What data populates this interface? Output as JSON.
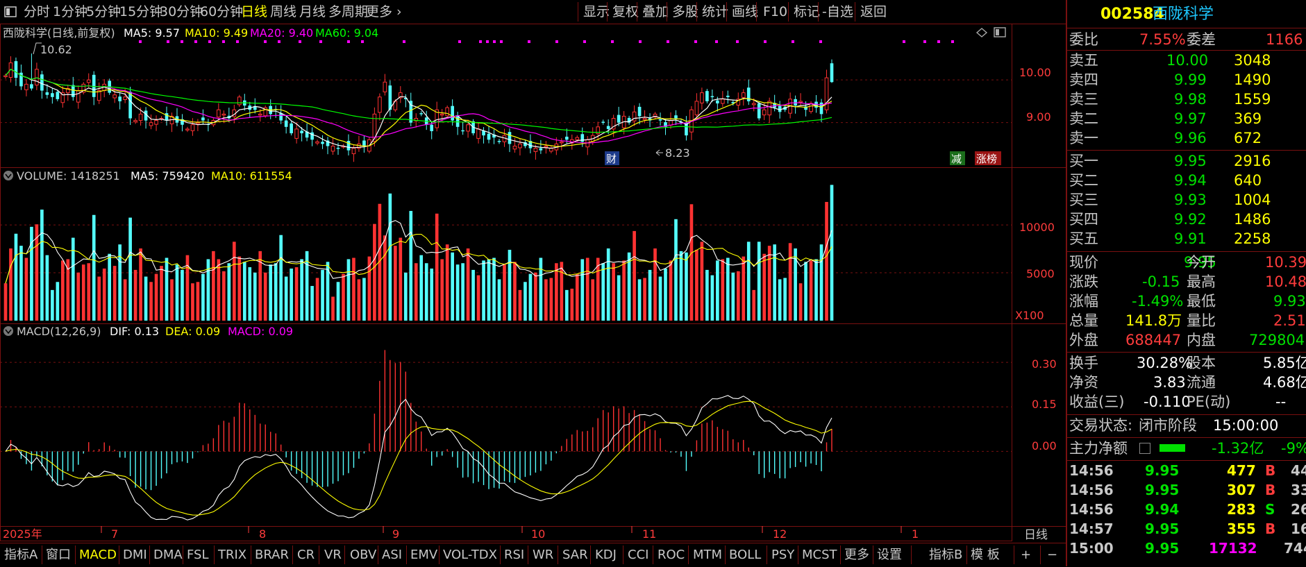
{
  "topbar": {
    "menu_icon": "menu-icon",
    "periods": [
      "分时",
      "1分钟",
      "5分钟",
      "15分钟",
      "30分钟",
      "60分钟",
      "日线",
      "周线",
      "月线",
      "多周期",
      "更多"
    ],
    "active_period": "日线",
    "tools": [
      "显示",
      "复权",
      "叠加",
      "多股",
      "统计",
      "画线",
      "F10",
      "标记",
      "-自选",
      "返回"
    ]
  },
  "panels": {
    "kline_title": "西陇科学(日线,前复权)",
    "ma_labels": [
      {
        "text": "MA5: 9.57",
        "color": "#ffffff"
      },
      {
        "text": "MA10: 9.49",
        "color": "#ffff00"
      },
      {
        "text": "MA20: 9.40",
        "color": "#ff00ff"
      },
      {
        "text": "MA60: 9.04",
        "color": "#00ff00"
      }
    ],
    "kline_axis": [
      "10.00",
      "9.00"
    ],
    "high_label": "10.62",
    "low_label": "8.23",
    "badge_cai": "财",
    "badge_jian": "减",
    "badge_zhangbang": "涨榜",
    "volume_title": "VOLUME: 1418251",
    "vol_ma_labels": [
      {
        "text": "MA5: 759420",
        "color": "#ffffff"
      },
      {
        "text": "MA10: 611554",
        "color": "#ffff00"
      }
    ],
    "volume_axis": [
      "10000",
      "5000"
    ],
    "volume_unit": "X100",
    "macd_title": "MACD(12,26,9)",
    "macd_labels": [
      {
        "text": "DIF: 0.13",
        "color": "#ffffff"
      },
      {
        "text": "DEA: 0.09",
        "color": "#ffff00"
      },
      {
        "text": "MACD: 0.09",
        "color": "#ff00ff"
      }
    ],
    "macd_axis": [
      "0.30",
      "0.15",
      "0.00"
    ],
    "date_labels": [
      "2025年",
      "7",
      "8",
      "9",
      "10",
      "11",
      "12",
      "1"
    ],
    "period_name": "日线"
  },
  "chart_data": {
    "type": "candlestick",
    "title": "西陇科学(日线,前复权)",
    "x": "trading days, 2025年6月 – 2026年1月",
    "date_ticks": [
      "2025年",
      "7",
      "8",
      "9",
      "10",
      "11",
      "12",
      "1"
    ],
    "close": [
      10.1,
      10.4,
      10.05,
      9.85,
      9.9,
      9.8,
      10.25,
      9.75,
      9.65,
      9.6,
      9.55,
      9.7,
      9.8,
      9.6,
      9.75,
      9.9,
      10.0,
      9.6,
      9.75,
      9.9,
      9.7,
      9.65,
      9.5,
      9.6,
      9.1,
      9.05,
      9.2,
      9.05,
      9.0,
      9.05,
      9.1,
      9.05,
      9.15,
      9.0,
      8.95,
      8.85,
      8.95,
      9.0,
      9.05,
      8.95,
      9.05,
      9.3,
      9.2,
      9.1,
      9.3,
      9.6,
      9.4,
      9.3,
      9.3,
      9.2,
      9.35,
      9.2,
      9.3,
      9.05,
      8.9,
      8.75,
      8.85,
      8.75,
      8.65,
      8.6,
      8.55,
      8.5,
      8.45,
      8.45,
      8.4,
      8.45,
      8.35,
      8.4,
      8.5,
      8.45,
      8.6,
      9.2,
      9.6,
      9.95,
      9.3,
      9.5,
      9.7,
      9.55,
      9.0,
      9.1,
      9.2,
      8.95,
      8.8,
      9.3,
      9.2,
      9.35,
      9.05,
      8.9,
      8.8,
      8.95,
      8.75,
      8.85,
      8.7,
      8.6,
      8.65,
      8.55,
      8.7,
      8.5,
      8.45,
      8.5,
      8.45,
      8.4,
      8.4,
      8.35,
      8.45,
      8.4,
      8.5,
      8.55,
      8.6,
      8.6,
      8.65,
      8.55,
      8.6,
      8.7,
      8.9,
      9.0,
      8.85,
      9.1,
      9.0,
      9.15,
      9.0,
      9.25,
      9.15,
      9.1,
      9.05,
      9.2,
      9.05,
      8.9,
      9.05,
      9.1,
      9.0,
      8.7,
      9.3,
      9.5,
      9.7,
      9.5,
      9.6,
      9.45,
      9.55,
      9.6,
      9.45,
      9.55,
      9.7,
      9.5,
      9.45,
      9.1,
      9.3,
      9.5,
      9.35,
      9.25,
      9.3,
      9.55,
      9.4,
      9.5,
      9.3,
      9.45,
      9.35,
      9.2,
      10.05,
      9.95
    ],
    "ma": {
      "MA5": 9.57,
      "MA10": 9.49,
      "MA20": 9.4,
      "MA60": 9.04
    },
    "high_marker": 10.62,
    "low_marker": 8.23,
    "ylim_price": [
      8.1,
      10.8
    ],
    "volume_last": 1418251,
    "volume_unit": "X100",
    "ylim_volume": [
      0,
      14500
    ],
    "macd": {
      "DIF": 0.13,
      "DEA": 0.09,
      "MACD": 0.09
    },
    "ylim_macd": [
      -0.28,
      0.38
    ]
  },
  "quote": {
    "code": "002584",
    "name": "西陇科学",
    "weibi_label": "委比",
    "weibi_value": "7.55%",
    "weicha_label": "委差",
    "weicha_value": "1166",
    "asks": [
      {
        "label": "卖五",
        "price": "10.00",
        "vol": "3048"
      },
      {
        "label": "卖四",
        "price": "9.99",
        "vol": "1490"
      },
      {
        "label": "卖三",
        "price": "9.98",
        "vol": "1559"
      },
      {
        "label": "卖二",
        "price": "9.97",
        "vol": "369"
      },
      {
        "label": "卖一",
        "price": "9.96",
        "vol": "672"
      }
    ],
    "bids": [
      {
        "label": "买一",
        "price": "9.95",
        "vol": "2916"
      },
      {
        "label": "买二",
        "price": "9.94",
        "vol": "640"
      },
      {
        "label": "买三",
        "price": "9.93",
        "vol": "1004"
      },
      {
        "label": "买四",
        "price": "9.92",
        "vol": "1486"
      },
      {
        "label": "买五",
        "price": "9.91",
        "vol": "2258"
      }
    ],
    "stats": [
      {
        "l1": "现价",
        "v1": "9.95",
        "c1": "#00e000",
        "l2": "今开",
        "v2": "10.39",
        "c2": "#ff3c3c"
      },
      {
        "l1": "涨跌",
        "v1": "-0.15",
        "c1": "#00e000",
        "l2": "最高",
        "v2": "10.48",
        "c2": "#ff3c3c"
      },
      {
        "l1": "涨幅",
        "v1": "-1.49%",
        "c1": "#00e000",
        "l2": "最低",
        "v2": "9.93",
        "c2": "#00e000"
      },
      {
        "l1": "总量",
        "v1": "141.8万",
        "c1": "#ffff00",
        "l2": "量比",
        "v2": "2.51",
        "c2": "#ff3c3c"
      },
      {
        "l1": "外盘",
        "v1": "688447",
        "c1": "#ff3c3c",
        "l2": "内盘",
        "v2": "729804",
        "c2": "#00e000"
      }
    ],
    "stats2": [
      {
        "l1": "换手",
        "v1": "30.28%",
        "l2": "股本",
        "v2": "5.85亿"
      },
      {
        "l1": "净资",
        "v1": "3.83",
        "l2": "流通",
        "v2": "4.68亿"
      },
      {
        "l1": "收益(三)",
        "v1": "-0.110",
        "l2": "PE(动)",
        "v2": "--"
      }
    ],
    "status_label": "交易状态:",
    "status_value": "闭市阶段",
    "status_time": "15:00:00",
    "flow_label": "主力净额",
    "flow_value": "-1.32亿",
    "flow_pct": "-9%",
    "ticks": [
      {
        "time": "14:56",
        "price": "9.95",
        "vol": "477",
        "side": "B",
        "num": "44"
      },
      {
        "time": "14:56",
        "price": "9.95",
        "vol": "307",
        "side": "B",
        "num": "33"
      },
      {
        "time": "14:56",
        "price": "9.94",
        "vol": "283",
        "side": "S",
        "num": "26"
      },
      {
        "time": "14:57",
        "price": "9.95",
        "vol": "355",
        "side": "B",
        "num": "16"
      },
      {
        "time": "15:00",
        "price": "9.95",
        "vol": "17132",
        "side": "",
        "num": "744"
      }
    ]
  },
  "bottombar": {
    "left_items": [
      "指标A",
      "窗口",
      "MACD",
      "DMI",
      "DMA",
      "FSL",
      "TRIX",
      "BRAR",
      "CR",
      "VR",
      "OBV",
      "ASI",
      "EMV",
      "VOL-TDX",
      "RSI",
      "WR",
      "SAR",
      "KDJ",
      "CCI",
      "ROC",
      "MTM",
      "BOLL",
      "PSY",
      "MCST",
      "更多",
      "设置"
    ],
    "active_indicator": "MACD",
    "right_items": [
      "指标B",
      "模 板",
      "+",
      "−"
    ]
  },
  "colors": {
    "up": "#ff3232",
    "down": "#54ffff",
    "grid": "#7a1010",
    "axis_text": "#ff3c3c",
    "ma5": "#ffffff",
    "ma10": "#ffff00",
    "ma20": "#ff00ff",
    "ma60": "#00ff00"
  }
}
